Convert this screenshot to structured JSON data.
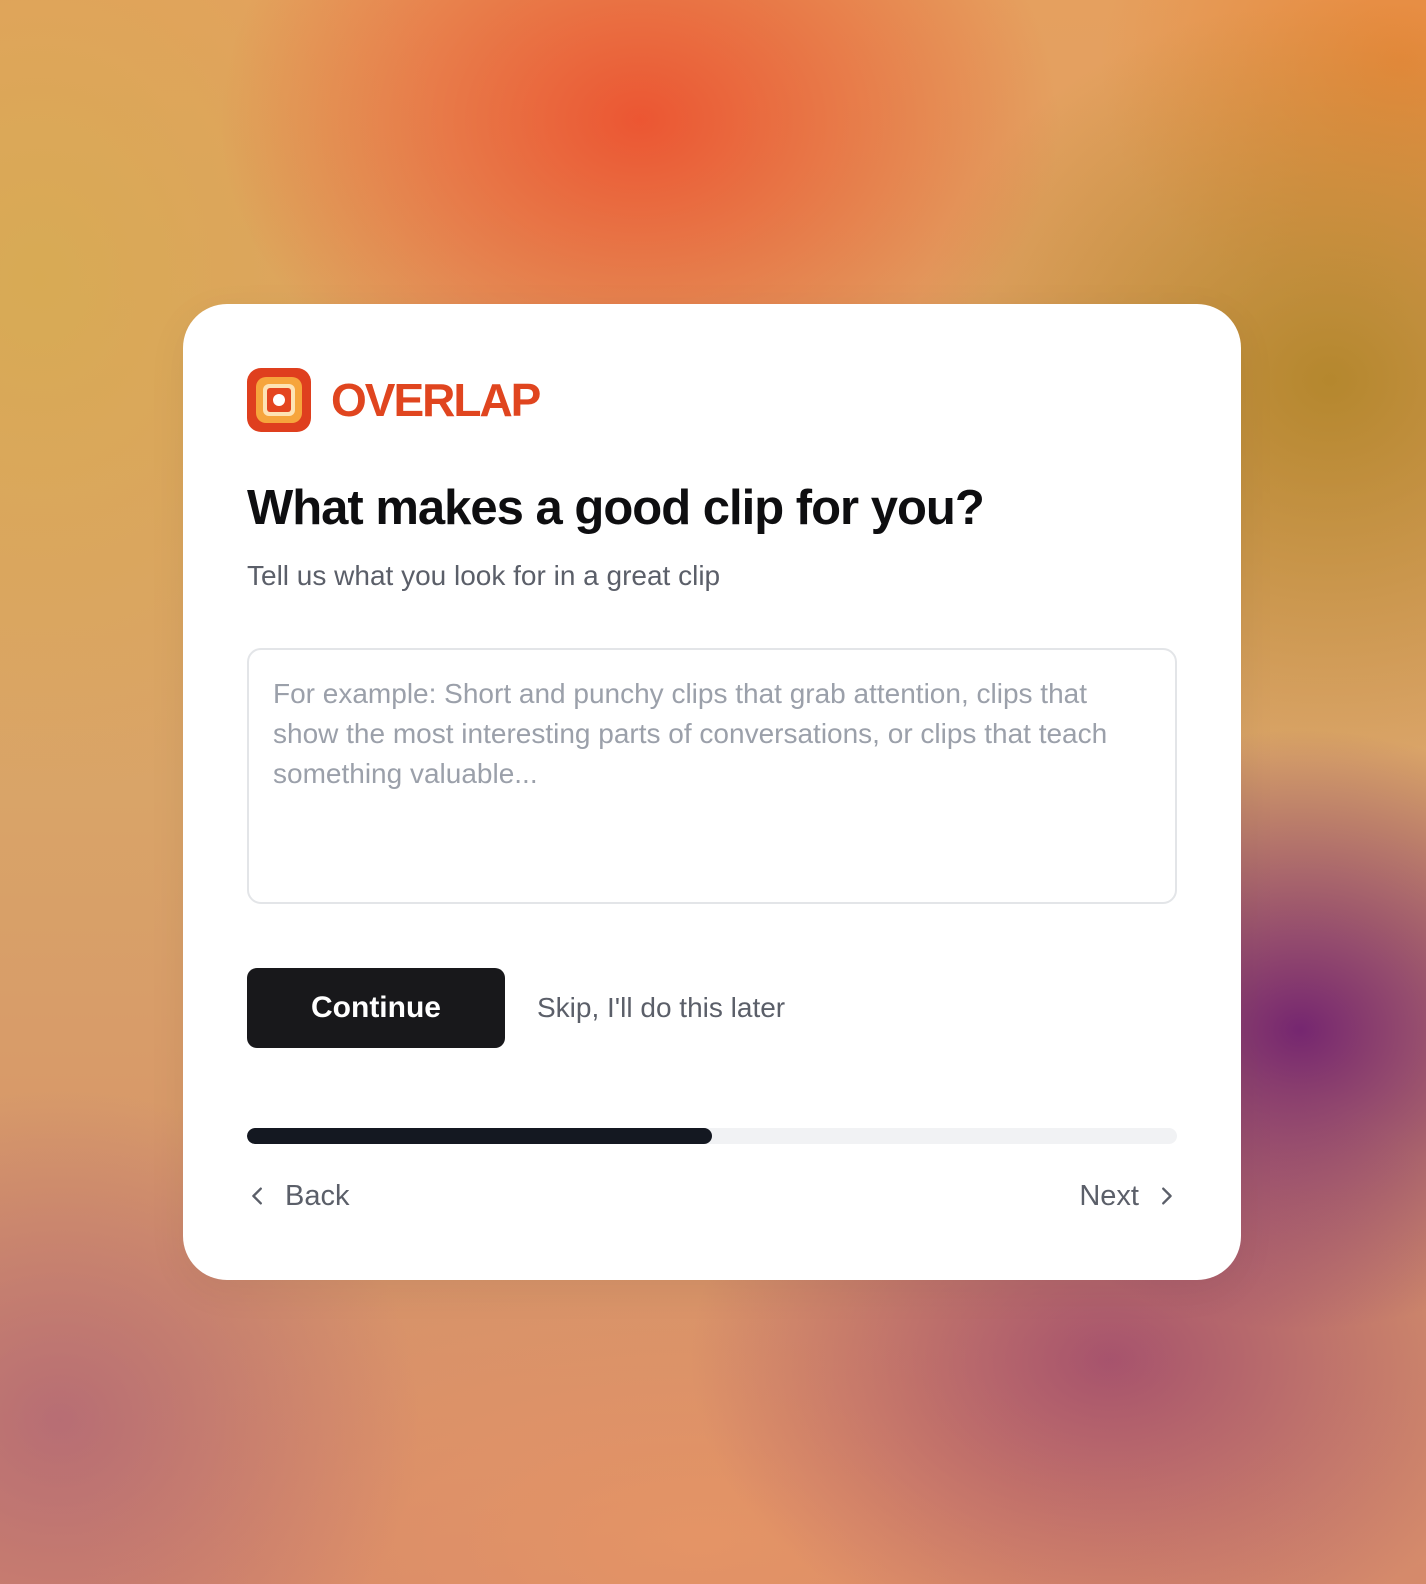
{
  "brand": {
    "name": "OVERLAP",
    "logo_icon": "overlap-logo-icon",
    "color": "#e0451f"
  },
  "question": {
    "title": "What makes a good clip for you?",
    "subtitle": "Tell us what you look for in a great clip"
  },
  "answer": {
    "value": "",
    "placeholder": "For example: Short and punchy clips that grab attention, clips that show the most interesting parts of conversations, or clips that teach something valuable..."
  },
  "actions": {
    "continue_label": "Continue",
    "skip_label": "Skip, I'll do this later"
  },
  "progress": {
    "fraction": 0.5
  },
  "navigation": {
    "back_label": "Back",
    "back_icon": "chevron-left-icon",
    "next_label": "Next",
    "next_icon": "chevron-right-icon"
  }
}
